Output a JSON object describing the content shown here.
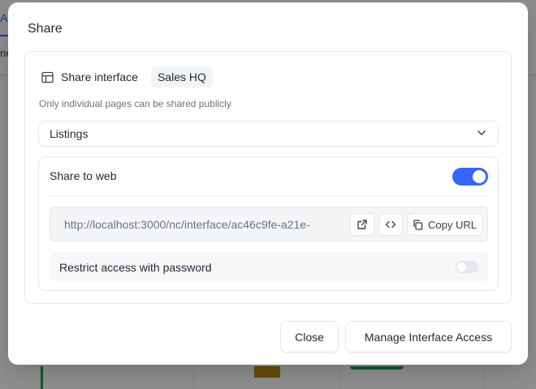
{
  "modal": {
    "title": "Share",
    "share_label": "Share interface",
    "interface_name": "Sales HQ",
    "hint": "Only individual pages can be shared publicly",
    "page_select": {
      "value": "Listings"
    },
    "share_web": {
      "label": "Share to web",
      "enabled": true,
      "url": "http://localhost:3000/nc/interface/ac46c9fe-a21e-",
      "copy_label": "Copy URL"
    },
    "restrict": {
      "label": "Restrict access with password",
      "enabled": false
    },
    "footer": {
      "close_label": "Close",
      "manage_label": "Manage Interface Access"
    }
  },
  "icons": {
    "layout": "layout-icon",
    "chevron": "chevron-down-icon",
    "open": "external-link-icon",
    "embed": "code-icon",
    "copy": "copy-icon"
  },
  "colors": {
    "accent": "#3366ff",
    "toggle_off": "#e5e7eb"
  }
}
